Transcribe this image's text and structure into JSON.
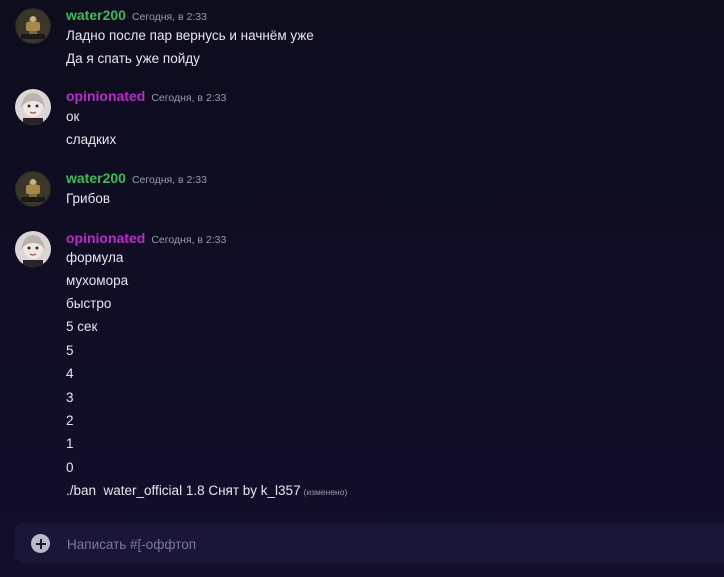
{
  "messages": [
    {
      "author": "water200",
      "timestamp": "Сегодня, в 2:33",
      "lines": [
        "Ладно после пар вернусь и начнём уже",
        "Да я спать уже пойду"
      ]
    },
    {
      "author": "opinionated",
      "timestamp": "Сегодня, в 2:33",
      "lines": [
        "ок",
        "сладких"
      ]
    },
    {
      "author": "water200",
      "timestamp": "Сегодня, в 2:33",
      "lines": [
        "Грибов"
      ]
    },
    {
      "author": "opinionated",
      "timestamp": "Сегодня, в 2:33",
      "lines": [
        "формула",
        "мухомора",
        "быстро",
        "5 сек",
        "5",
        "4",
        "3",
        "2",
        "1",
        "0",
        "./ban  water_official 1.8 Снят by k_l357"
      ],
      "edited_label": "(изменено)"
    }
  ],
  "composer": {
    "placeholder": "Написать #[-оффтоп",
    "value": ""
  },
  "colors": {
    "water200": "#3fba5a",
    "opinionated": "#b72fc9",
    "composer_bg": "#1a1637"
  },
  "icons": {
    "add": "plus-circle-icon"
  }
}
